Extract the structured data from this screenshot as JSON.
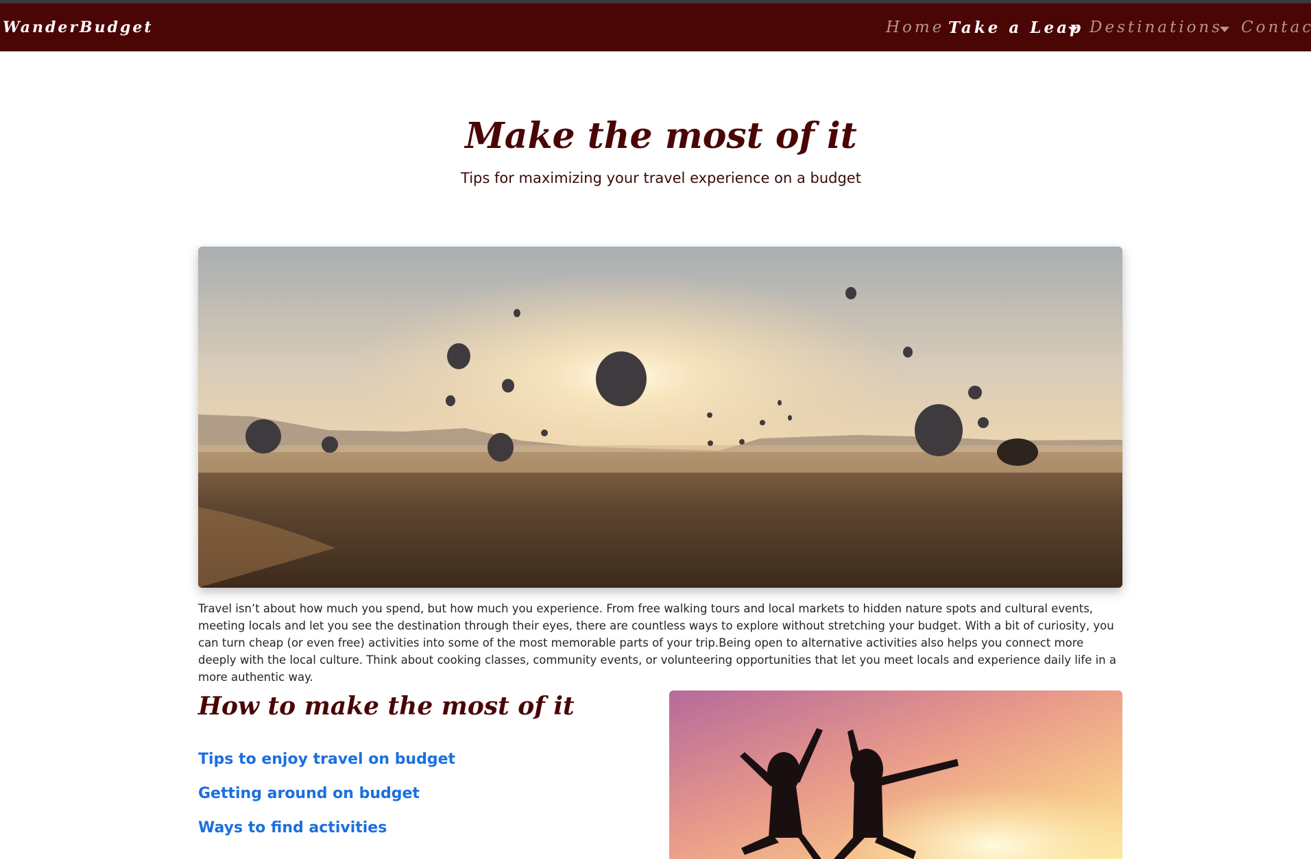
{
  "brand": "WanderBudget",
  "nav": {
    "home": "Home",
    "take_a_leap": "Take a Leap",
    "destinations": "Destinations",
    "contact": "Contact"
  },
  "hero": {
    "title": "Make the most of it",
    "subtitle": "Tips for maximizing your travel experience on a budget"
  },
  "article": {
    "paragraph": "Travel isn’t about how much you spend, but how much you experience. From free walking tours and local markets to hidden nature spots and cultural events, meeting locals and let you see the destination through their eyes, there are countless ways to explore without stretching your budget. With a bit of curiosity, you can turn cheap (or even free) activities into some of the most memorable parts of your trip.Being open to alternative activities also helps you connect more deeply with the local culture. Think about cooking classes, community events, or volunteering opportunities that let you meet locals and experience daily life in a more authentic way."
  },
  "section": {
    "title": "How to make the most of it",
    "links": [
      "Tips to enjoy travel on budget",
      "Getting around on budget",
      "Ways to find activities"
    ]
  },
  "colors": {
    "navbar": "#4a0505",
    "title": "#4a0505",
    "link": "#1a6fe0",
    "nav_inactive": "#b5958e"
  }
}
